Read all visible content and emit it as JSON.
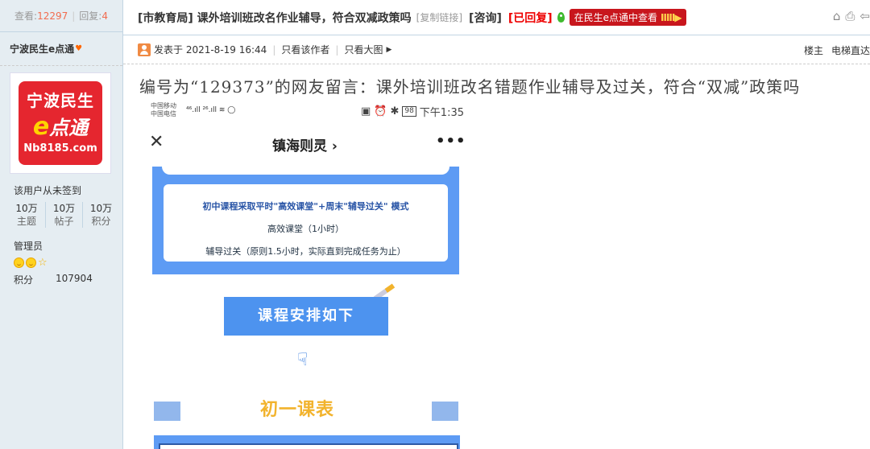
{
  "sidebar": {
    "views_label": "查看:",
    "views_value": "12297",
    "replies_label": "回复:",
    "replies_value": "4",
    "author_name": "宁波民生e点通",
    "avatar": {
      "line1": "宁波民生",
      "line2_e": "e",
      "line2_rest": "点通",
      "line3": "Nb8185.com"
    },
    "signin_text": "该用户从未签到",
    "counts": [
      {
        "value": "10万",
        "label": "主题"
      },
      {
        "value": "10万",
        "label": "帖子"
      },
      {
        "value": "10万",
        "label": "积分"
      }
    ],
    "role": "管理员",
    "points_label": "积分",
    "points_value": "107904"
  },
  "thread": {
    "title": "[市教育局] 课外培训班改名作业辅导，符合双减政策吗",
    "copy_link": "[复制链接]",
    "tag": "[咨询]",
    "status": "[已回复]",
    "view_button": "在民生e点通中查看",
    "view_button_bars": "IIIII▶"
  },
  "meta": {
    "posted": "发表于 2021-8-19 16:44",
    "only_author": "只看该作者",
    "only_big_image": "只看大图",
    "floor": "楼主",
    "elevator": "电梯直达"
  },
  "post": {
    "text": "编号为“129373”的网友留言：课外培训班改名错题作业辅导及过关，符合“双减”政策吗"
  },
  "phone": {
    "carrier1": "中国移动",
    "carrier2": "中国电信",
    "signal": "⁴⁶.ıll ²⁶.ıll ≋ ◯",
    "battery": "98",
    "time": "下午1:35",
    "nav_title": "镇海则灵 ›",
    "card_line1": "初中课程采取平时\"高效课堂\"+周末\"辅导过关\" 模式",
    "card_line2": "高效课堂（1小时）",
    "card_line3": "辅导过关（原则1.5小时，实际直到完成任务为止）",
    "button": "课程安排如下",
    "grade_title": "初一课表"
  }
}
